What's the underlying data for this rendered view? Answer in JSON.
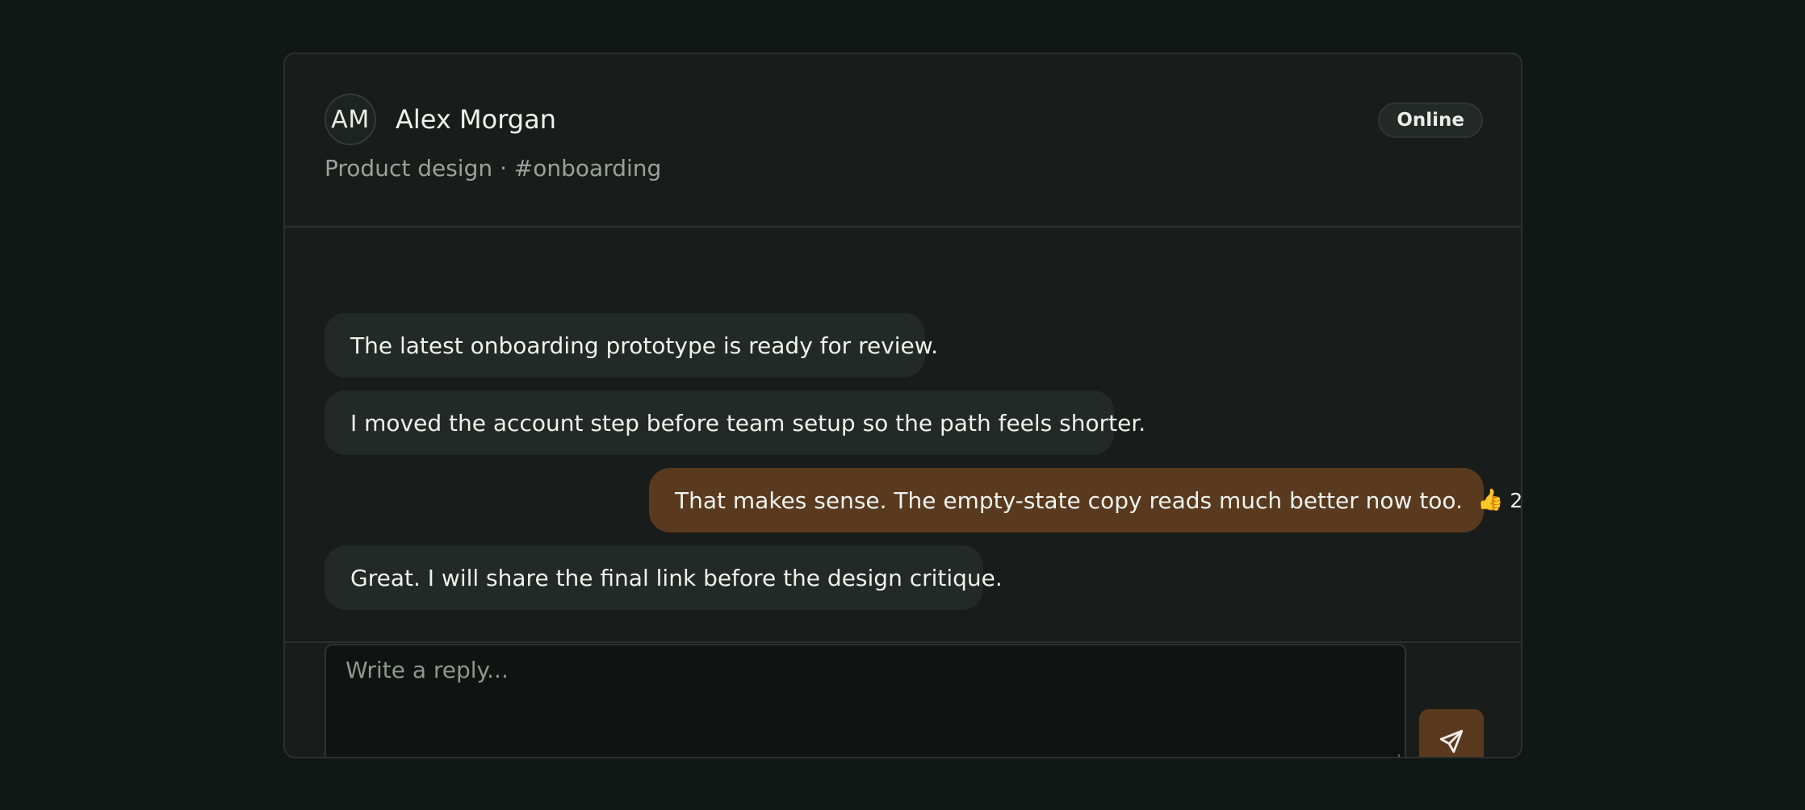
{
  "contact": {
    "initials": "AM",
    "name": "Alex Morgan",
    "subtitle": "Product design · #onboarding",
    "status": "Online"
  },
  "messages": [
    {
      "text": "The latest onboarding prototype is ready for review.",
      "from": "other"
    },
    {
      "text": "I moved the account step before team setup so the path feels shorter.",
      "from": "other"
    },
    {
      "text": "That makes sense. The empty-state copy reads much better now too.",
      "from": "me",
      "reaction": {
        "emoji": "👍",
        "count": "2"
      }
    },
    {
      "text": "Great. I will share the final link before the design critique.",
      "from": "other"
    }
  ],
  "composer": {
    "placeholder": "Write a reply...",
    "send_icon": "paper-plane-icon"
  },
  "colors": {
    "background": "#111715",
    "card": "#181d1b",
    "incoming_bubble": "#222927",
    "outgoing_bubble": "#5a3a1f",
    "send_button": "#5a3a1f"
  }
}
